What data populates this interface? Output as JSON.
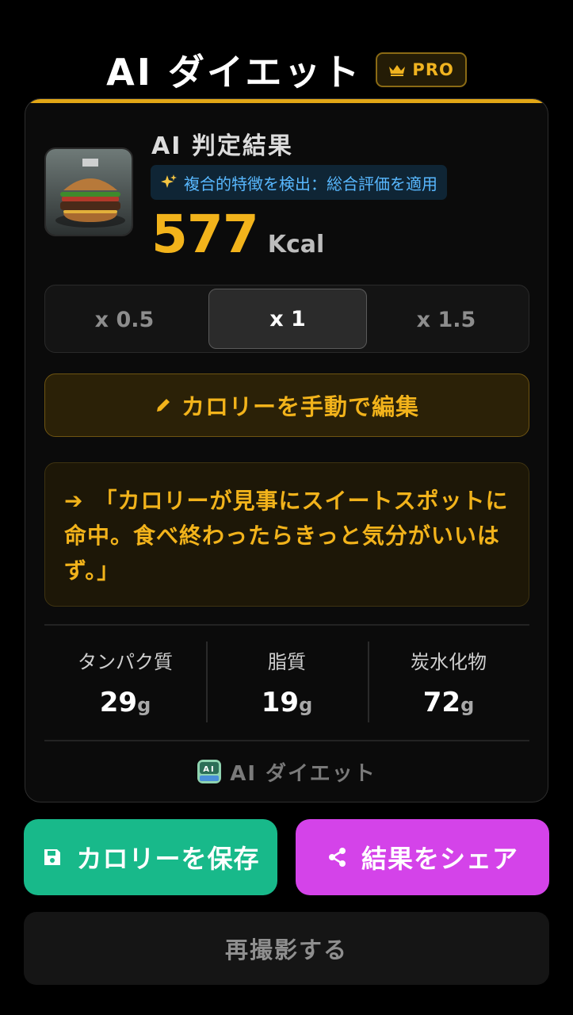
{
  "header": {
    "title": "AI ダイエット",
    "badge": "PRO",
    "badge_icon": "crown-icon"
  },
  "result": {
    "title": "AI 判定結果",
    "tag": "複合的特徴を検出：総合評価を適用",
    "tag_icon": "sparkles-icon",
    "calories": "577",
    "unit": "Kcal"
  },
  "portion": {
    "options": [
      "x 0.5",
      "x 1",
      "x 1.5"
    ],
    "selected": "x 1"
  },
  "edit": {
    "label": "カロリーを手動で編集",
    "icon": "pencil-icon"
  },
  "comment": {
    "arrow": "➔",
    "text": "「カロリーが見事にスイートスポットに命中。食べ終わったらきっと気分がいいはず。」"
  },
  "nutrition": [
    {
      "label": "タンパク質",
      "value": "29",
      "unit": "g"
    },
    {
      "label": "脂質",
      "value": "19",
      "unit": "g"
    },
    {
      "label": "炭水化物",
      "value": "72",
      "unit": "g"
    }
  ],
  "brand": {
    "name": "AI ダイエット"
  },
  "actions": {
    "save": "カロリーを保存",
    "share": "結果をシェア",
    "retake": "再撮影する"
  },
  "colors": {
    "accent": "#f2b31b",
    "save": "#18b98a",
    "share": "#d443e9",
    "tag_text": "#58b8ff"
  }
}
